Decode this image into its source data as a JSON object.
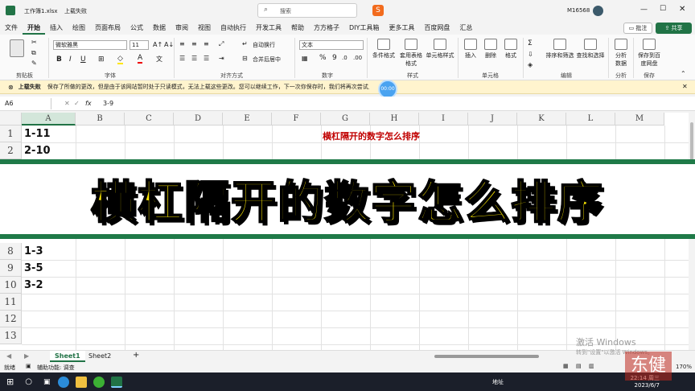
{
  "title": {
    "filename": "工作簿1.xlsx",
    "upload_status": "上载失败",
    "search_placeholder": "搜索",
    "user": "M16568"
  },
  "ribbon_tabs": [
    "文件",
    "开始",
    "插入",
    "绘图",
    "页面布局",
    "公式",
    "数据",
    "审阅",
    "视图",
    "自动执行",
    "开发工具",
    "帮助",
    "方方格子",
    "DIY工具箱",
    "更多工具",
    "百度网盘",
    "汇总"
  ],
  "active_tab": "开始",
  "ribbon_right": {
    "comments": "批注",
    "share": "共享"
  },
  "ribbon": {
    "font_name": "微软雅黑",
    "font_size": "11",
    "number_format": "文本",
    "groups": [
      "剪贴板",
      "字体",
      "对齐方式",
      "数字",
      "样式",
      "单元格",
      "编辑",
      "分析",
      "保存"
    ],
    "wrap": "自动换行",
    "merge": "合并后居中",
    "cond_format": "条件格式",
    "table_format": "套用表格格式",
    "cell_style": "单元格样式",
    "insert": "插入",
    "delete": "删除",
    "format": "格式",
    "sort_filter": "排序和筛选",
    "find_select": "查找和选择",
    "analyze": "分析数据",
    "save_baidu": "保存到百度网盘",
    "bold": "B",
    "italic": "I",
    "underline": "U",
    "font_color_letter": "A"
  },
  "message_bar": {
    "label": "上载失败",
    "text": "保存了所做的更改，但是由于该网站暂时处于只读模式，无法上载这些更改。您可以继续工作，下一次你保存时，我们将再次尝试上载。",
    "timer": "00:00"
  },
  "formula_bar": {
    "name_box": "A6",
    "fx": "fx",
    "value": "3-9"
  },
  "columns": [
    "A",
    "B",
    "C",
    "D",
    "E",
    "F",
    "G",
    "H",
    "I",
    "J",
    "K",
    "L",
    "M"
  ],
  "rows_top": [
    {
      "num": "1",
      "a": "1-11"
    },
    {
      "num": "2",
      "a": "2-10"
    }
  ],
  "rows_bottom": [
    {
      "num": "8",
      "a": "1-3"
    },
    {
      "num": "9",
      "a": "3-5"
    },
    {
      "num": "10",
      "a": "3-2"
    },
    {
      "num": "11",
      "a": ""
    },
    {
      "num": "12",
      "a": ""
    },
    {
      "num": "13",
      "a": ""
    }
  ],
  "sheet_title": "横杠隔开的数字怎么排序",
  "banner_text": "横杠隔开的数字怎么排序",
  "sheet_tabs": [
    "Sheet1",
    "Sheet2"
  ],
  "add_sheet": "+",
  "status": {
    "ready": "就绪",
    "accessibility": "辅助功能: 调查",
    "zoom": "170%"
  },
  "watermark": {
    "line1": "激活 Windows",
    "line2": "转到\"设置\"以激活 Windows。"
  },
  "taskbar": {
    "location": "地址",
    "time": "22:14 周三",
    "date": "2023/6/7"
  },
  "stamp": "东健",
  "colors": {
    "excel_green": "#217346",
    "banner_yellow": "#f5e100",
    "sheet_title_red": "#c00000"
  }
}
